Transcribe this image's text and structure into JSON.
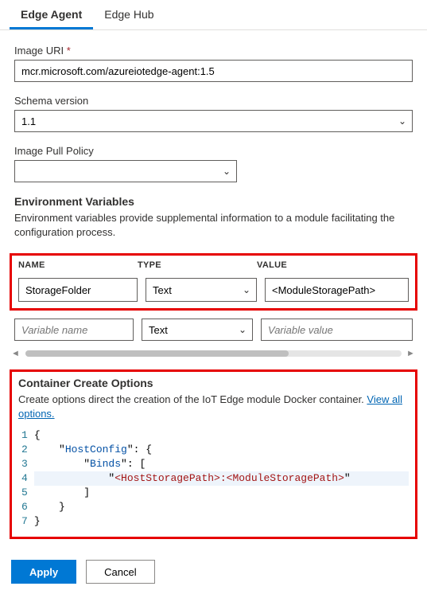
{
  "tabs": {
    "edgeAgent": "Edge Agent",
    "edgeHub": "Edge Hub"
  },
  "form": {
    "imageUri": {
      "label": "Image URI",
      "required": "*",
      "value": "mcr.microsoft.com/azureiotedge-agent:1.5"
    },
    "schemaVersion": {
      "label": "Schema version",
      "value": "1.1"
    },
    "imagePullPolicy": {
      "label": "Image Pull Policy",
      "value": ""
    }
  },
  "env": {
    "title": "Environment Variables",
    "desc": "Environment variables provide supplemental information to a module facilitating the configuration process.",
    "headers": {
      "name": "NAME",
      "type": "TYPE",
      "value": "VALUE"
    },
    "row1": {
      "name": "StorageFolder",
      "type": "Text",
      "value": "<ModuleStoragePath>"
    },
    "row2": {
      "namePh": "Variable name",
      "type": "Text",
      "valuePh": "Variable value"
    }
  },
  "container": {
    "title": "Container Create Options",
    "descPrefix": "Create options direct the creation of the IoT Edge module Docker container. ",
    "link": "View all options.",
    "code": {
      "l1": "{",
      "l2a": "    \"",
      "l2key": "HostConfig",
      "l2b": "\": {",
      "l3a": "        \"",
      "l3key": "Binds",
      "l3b": "\": [",
      "l4a": "            \"",
      "l4str": "<HostStoragePath>:<ModuleStoragePath>",
      "l4b": "\"",
      "l5": "        ]",
      "l6": "    }",
      "l7": "}"
    }
  },
  "buttons": {
    "apply": "Apply",
    "cancel": "Cancel"
  }
}
